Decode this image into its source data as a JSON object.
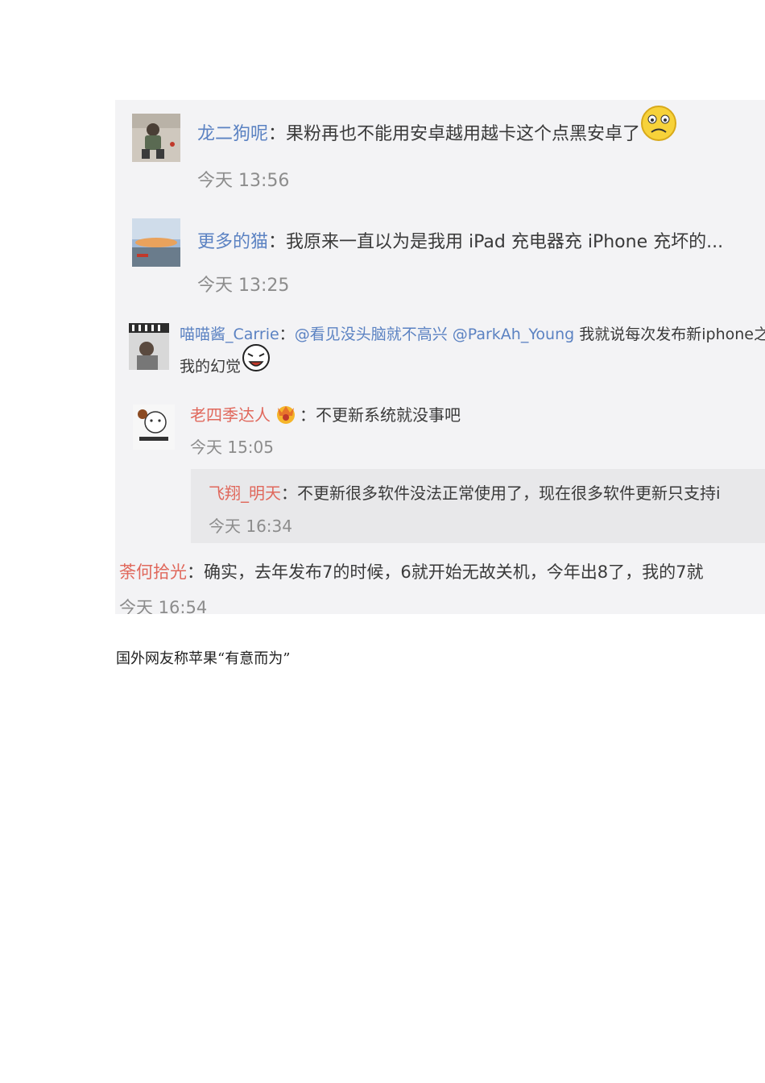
{
  "comments": [
    {
      "name": "龙二狗呢",
      "sep": "：",
      "text": "果粉再也不能用安卓越用越卡这个点黑安卓了",
      "emoji": "sad-face-emoji",
      "time": "今天 13:56"
    },
    {
      "name": "更多的猫",
      "sep": "：",
      "text": "我原来一直以为是我用 iPad 充电器充 iPhone 充坏的...",
      "time": "今天 13:25"
    },
    {
      "name": "喵喵酱_Carrie",
      "sep": "：",
      "mention1": "@看见没头脑就不高兴",
      "mention2": "@ParkAh_Young",
      "text": "我就说每次发布新iphone之",
      "text2": "我的幻觉",
      "emoji": "laughing-face-emoji"
    },
    {
      "name": "老四季达人",
      "badge": "vip-badge-emoji",
      "sep": "：",
      "text": "不更新系统就没事吧",
      "time": "今天 15:05"
    },
    {
      "name": "飞翔_明天",
      "sep": "：",
      "text": "不更新很多软件没法正常使用了，现在很多软件更新只支持i",
      "time": "今天 16:34"
    },
    {
      "name": "荼何拾光",
      "sep": "：",
      "text": "确实，去年发布7的时候，6就开始无故关机，今年出8了，我的7就",
      "time": "今天 16:54"
    }
  ],
  "caption": "国外网友称苹果“有意而为”",
  "colors": {
    "name_blue": "#5b82c2",
    "name_red": "#e0685c",
    "time_gray": "#8c8c8c",
    "panel_bg": "#f3f3f5",
    "reply_bg": "#e8e8ea"
  }
}
